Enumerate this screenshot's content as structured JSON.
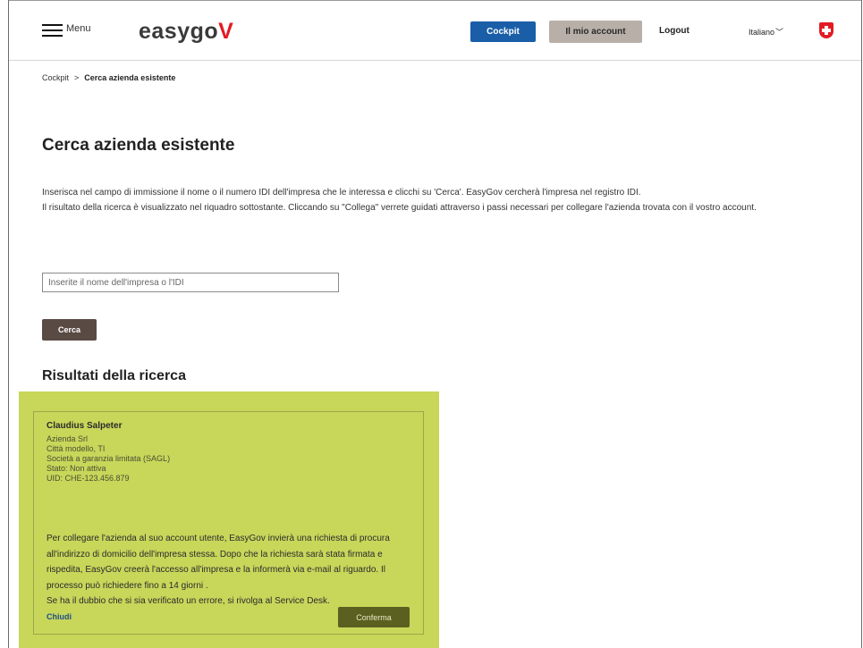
{
  "header": {
    "menu_label": "Menu",
    "logo_text": "easygo",
    "logo_accent": "V",
    "cockpit_button": "Cockpit",
    "account_button": "Il mio account",
    "logout_link": "Logout",
    "language": "Italiano"
  },
  "breadcrumb": {
    "home": "Cockpit",
    "separator": ">",
    "current": "Cerca azienda esistente"
  },
  "main": {
    "title": "Cerca azienda esistente",
    "intro_line1": "Inserisca nel campo di immissione il nome o il numero IDI dell'impresa che le interessa e clicchi su 'Cerca'. EasyGov cercherà l'impresa nel registro IDI.",
    "intro_line2": "Il risultato della ricerca è visualizzato nel riquadro sottostante. Cliccando su \"Collega\" verrete guidati attraverso i passi necessari per collegare l'azienda trovata con il vostro account.",
    "search_placeholder": "Inserite il nome dell'impresa o l'IDI",
    "search_value": "",
    "search_button": "Cerca",
    "results_title": "Risultati della ricerca"
  },
  "result_card": {
    "name": "Claudius Salpeter",
    "details": [
      "Azienda Srl",
      "Città modello, TI",
      "Società a garanzia limitata (SAGL)",
      "Stato: Non attiva",
      "UID: CHE-123.456.879"
    ],
    "info": "Per collegare l'azienda al suo account utente, EasyGov invierà una richiesta di procura all'indirizzo di domicilio dell'impresa stessa. Dopo che la richiesta sarà stata firmata e rispedita, EasyGov creerà l'accesso all'impresa e la informerà via e-mail al riguardo. Il processo può richiedere fino a 14 giorni .",
    "info_line2": "Se ha il dubbio che si sia verificato un errore, si rivolga al Service Desk.",
    "close_link": "Chiudi",
    "confirm_button": "Conferma"
  },
  "colors": {
    "primary_blue": "#1a5ea8",
    "account_button_bg": "#b8b0a8",
    "search_button_bg": "#5a4a44",
    "highlight_bg": "#c8d65a",
    "confirm_button_bg": "#5b5f1f",
    "brand_red": "#e31b23"
  },
  "icons": {
    "menu": "hamburger-icon",
    "language_dropdown": "chevron-down-icon",
    "flag": "swiss-flag-icon"
  }
}
